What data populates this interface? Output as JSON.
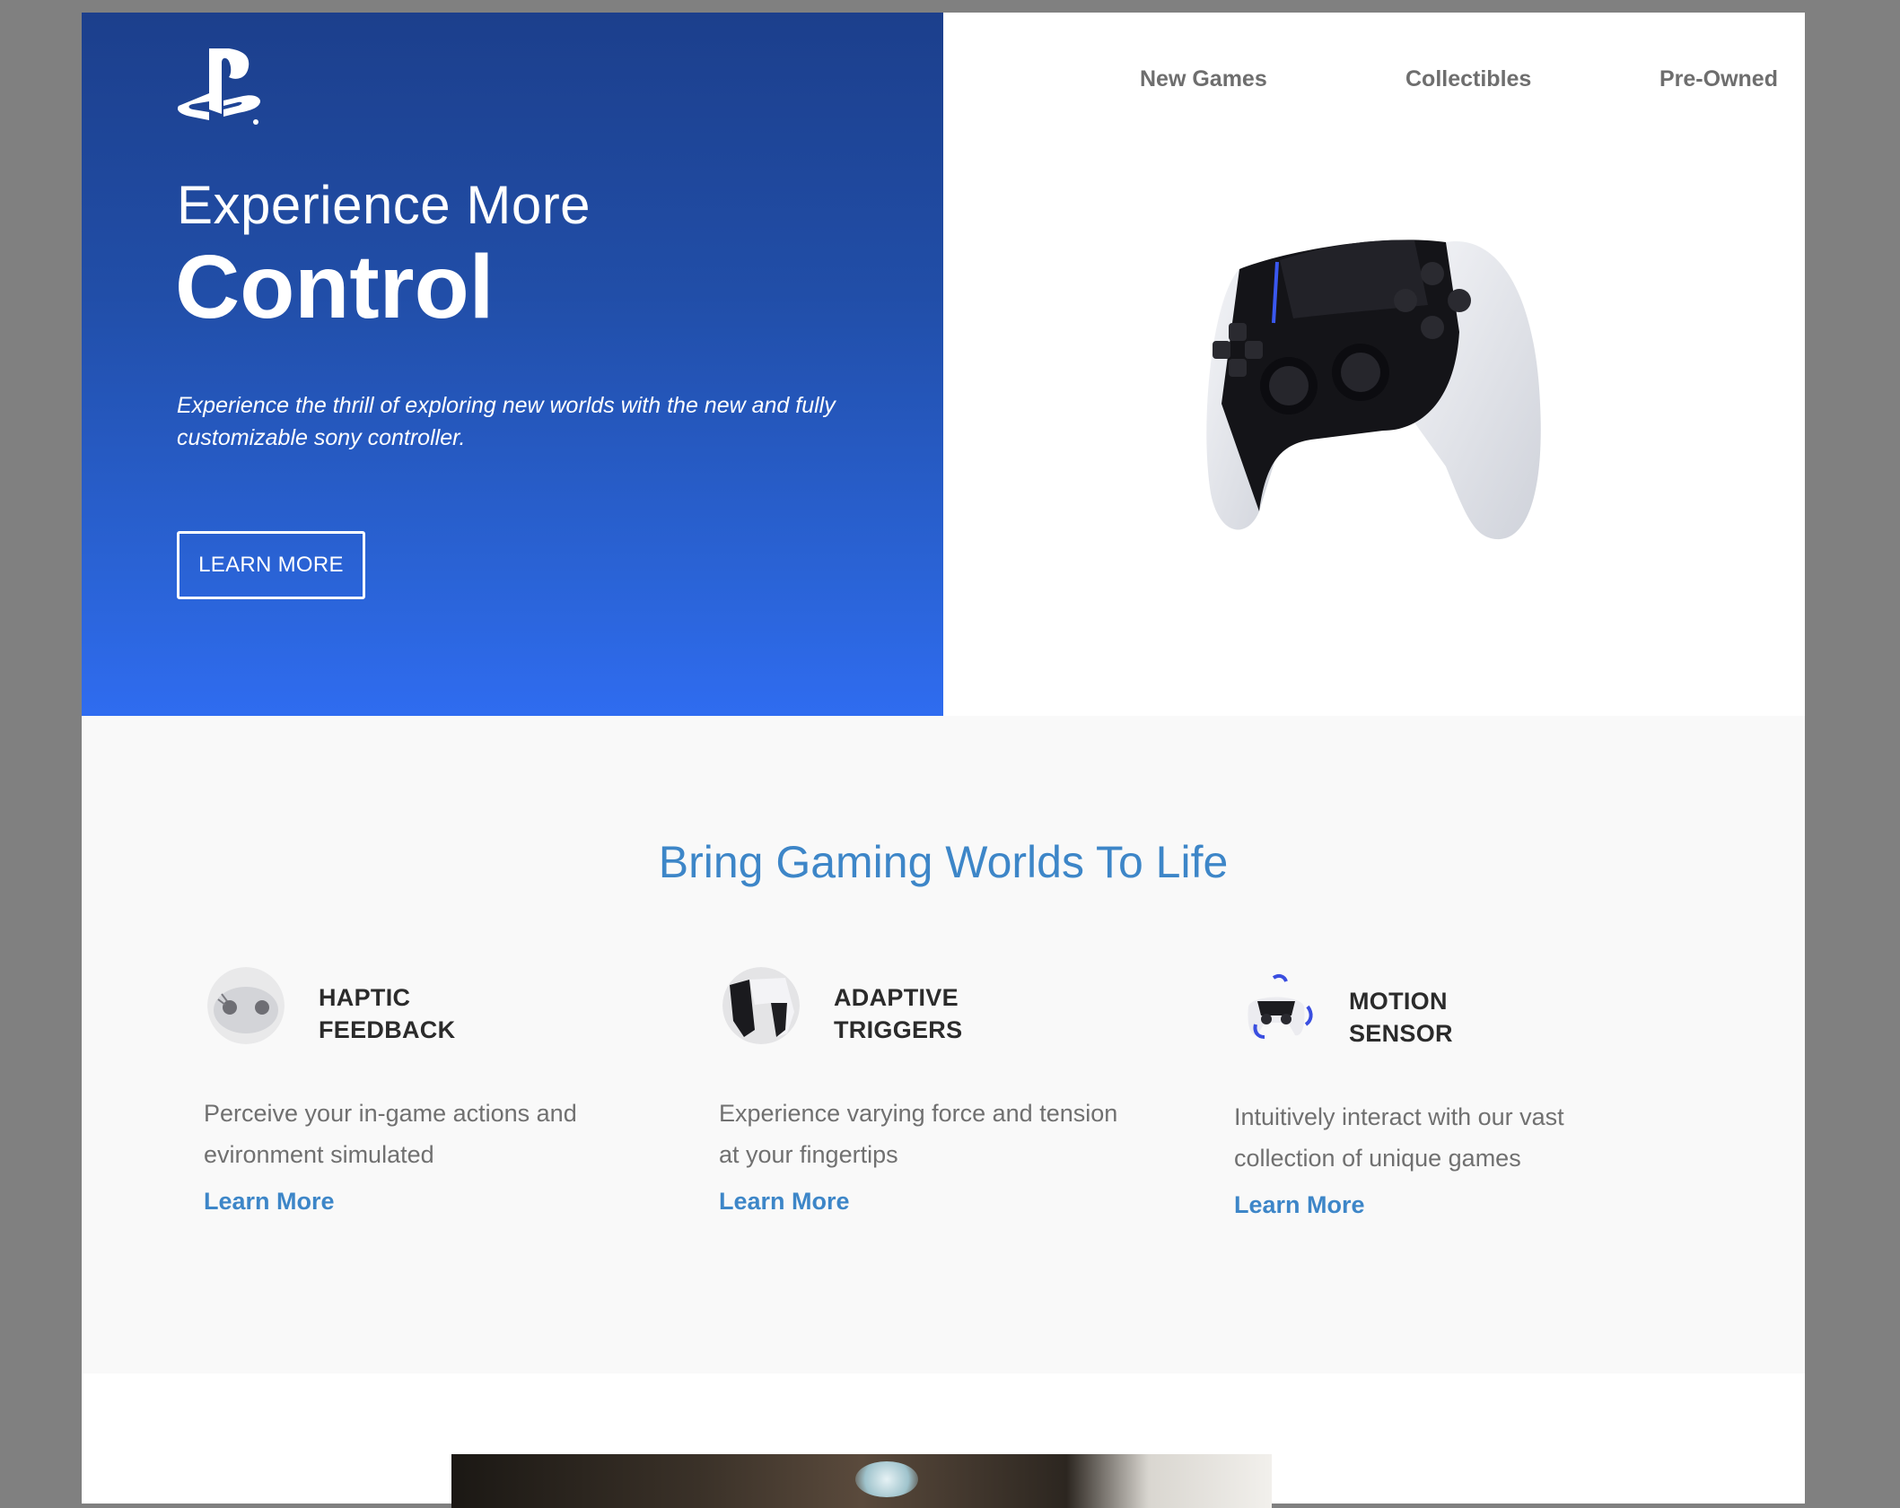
{
  "brand": {
    "logo": "playstation-logo"
  },
  "nav": {
    "items": [
      {
        "label": "New Games"
      },
      {
        "label": "Collectibles"
      },
      {
        "label": "Pre-Owned"
      }
    ]
  },
  "hero": {
    "eyebrow": "Experience More",
    "title": "Control",
    "description": "Experience the thrill of exploring new worlds with the new and fully customizable sony controller.",
    "cta_label": "LEARN MORE",
    "image": "dualsense-edge-controller"
  },
  "features": {
    "title": "Bring Gaming Worlds To Life",
    "items": [
      {
        "name_line1": "HAPTIC",
        "name_line2": "FEEDBACK",
        "description": "Perceive your in-game actions and evironment simulated",
        "link": "Learn More",
        "icon": "haptic-feedback-icon"
      },
      {
        "name_line1": "ADAPTIVE",
        "name_line2": "TRIGGERS",
        "description": "Experience varying force and tension at your fingertips",
        "link": "Learn More",
        "icon": "adaptive-triggers-icon"
      },
      {
        "name_line1": "MOTION",
        "name_line2": "SENSOR",
        "description": "Intuitively interact with our vast collection of unique games",
        "link": "Learn More",
        "icon": "motion-sensor-icon"
      }
    ]
  },
  "colors": {
    "hero_gradient_top": "#1c3f8c",
    "hero_gradient_bottom": "#2f6cf0",
    "accent": "#3d86c8",
    "section_bg": "#f9f9f9",
    "page_backdrop": "#808080"
  }
}
